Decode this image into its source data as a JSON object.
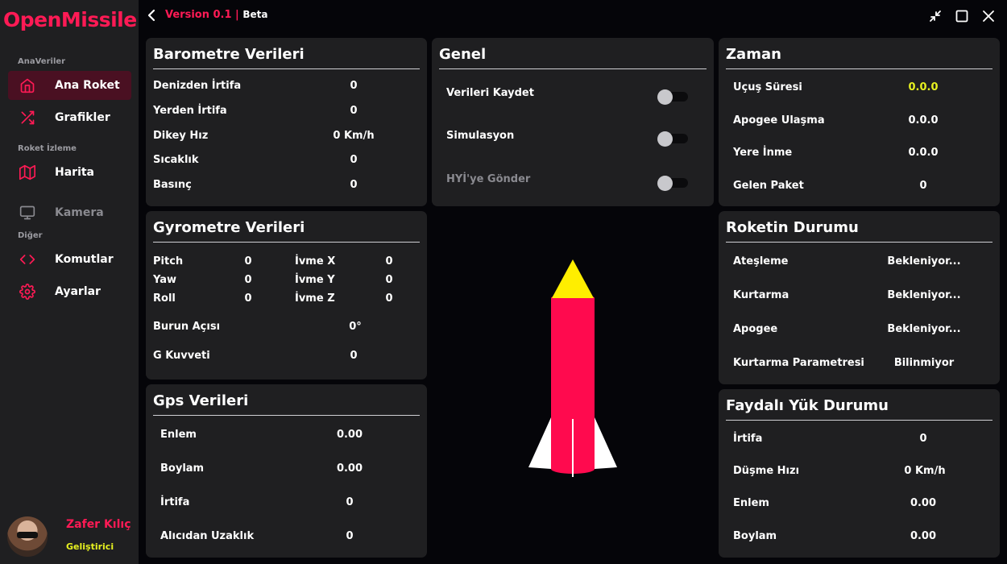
{
  "sidebar": {
    "brand": "OpenMissile",
    "sections": {
      "main": "AnaVeriler",
      "tracking": "Roket İzleme",
      "other": "Diğer"
    },
    "items": [
      {
        "label": "Ana Roket",
        "icon": "home-icon",
        "active": true
      },
      {
        "label": "Grafikler",
        "icon": "shuffle-icon"
      },
      {
        "label": "Harita",
        "icon": "map-icon"
      },
      {
        "label": "Kamera",
        "icon": "monitor-icon",
        "disabled": true
      },
      {
        "label": "Komutlar",
        "icon": "code-icon"
      },
      {
        "label": "Ayarlar",
        "icon": "gear-icon"
      }
    ],
    "user": {
      "name": "Zafer Kılıç",
      "role": "Geliştirici"
    }
  },
  "topbar": {
    "version": "Version 0.1 |",
    "beta": "Beta",
    "icons": [
      "back-chevron-icon",
      "minimize-icon",
      "maximize-icon",
      "close-icon"
    ]
  },
  "barometer": {
    "title": "Barometre Verileri",
    "rows": [
      {
        "label": "Denizden İrtifa",
        "value": "0"
      },
      {
        "label": "Yerden İrtifa",
        "value": "0"
      },
      {
        "label": "Dikey Hız",
        "value": "0 Km/h"
      },
      {
        "label": "Sıcaklık",
        "value": "0"
      },
      {
        "label": "Basınç",
        "value": "0"
      }
    ]
  },
  "gyro": {
    "title": "Gyrometre Verileri",
    "grid": [
      {
        "label": "Pitch",
        "value": "0",
        "label2": "İvme X",
        "value2": "0"
      },
      {
        "label": "Yaw",
        "value": "0",
        "label2": "İvme Y",
        "value2": "0"
      },
      {
        "label": "Roll",
        "value": "0",
        "label2": "İvme Z",
        "value2": "0"
      }
    ],
    "nose_label": "Burun Açısı",
    "nose_value": "0°",
    "g_label": "G Kuvveti",
    "g_value": "0"
  },
  "gps": {
    "title": "Gps Verileri",
    "rows": [
      {
        "label": "Enlem",
        "value": "0.00"
      },
      {
        "label": "Boylam",
        "value": "0.00"
      },
      {
        "label": "İrtifa",
        "value": "0"
      },
      {
        "label": "Alıcıdan Uzaklık",
        "value": "0"
      }
    ]
  },
  "general": {
    "title": "Genel",
    "toggles": [
      {
        "label": "Verileri Kaydet",
        "on": false
      },
      {
        "label": "Simulasyon",
        "on": false
      },
      {
        "label": "HYİ'ye Gönder",
        "on": false,
        "disabled": true
      }
    ]
  },
  "time": {
    "title": "Zaman",
    "rows": [
      {
        "label": "Uçuş Süresi",
        "value": "0.0.0",
        "highlight": true
      },
      {
        "label": "Apogee Ulaşma",
        "value": "0.0.0"
      },
      {
        "label": "Yere İnme",
        "value": "0.0.0"
      },
      {
        "label": "Gelen Paket",
        "value": "0"
      }
    ]
  },
  "rocket_status": {
    "title": "Roketin Durumu",
    "rows": [
      {
        "label": "Ateşleme",
        "value": "Bekleniyor..."
      },
      {
        "label": "Kurtarma",
        "value": "Bekleniyor..."
      },
      {
        "label": "Apogee",
        "value": "Bekleniyor..."
      },
      {
        "label": "Kurtarma Parametresi",
        "value": "Bilinmiyor"
      }
    ]
  },
  "payload": {
    "title": "Faydalı Yük Durumu",
    "rows": [
      {
        "label": "İrtifa",
        "value": "0"
      },
      {
        "label": "Düşme Hızı",
        "value": "0 Km/h"
      },
      {
        "label": "Enlem",
        "value": "0.00"
      },
      {
        "label": "Boylam",
        "value": "0.00"
      }
    ]
  },
  "colors": {
    "accent": "#ff1a55",
    "highlight": "#e6f020",
    "panel": "#1f1f21",
    "background": "#050509",
    "rocket_body": "#ff0a4e",
    "rocket_nose": "#ffee00",
    "rocket_fins": "#ffffff"
  }
}
